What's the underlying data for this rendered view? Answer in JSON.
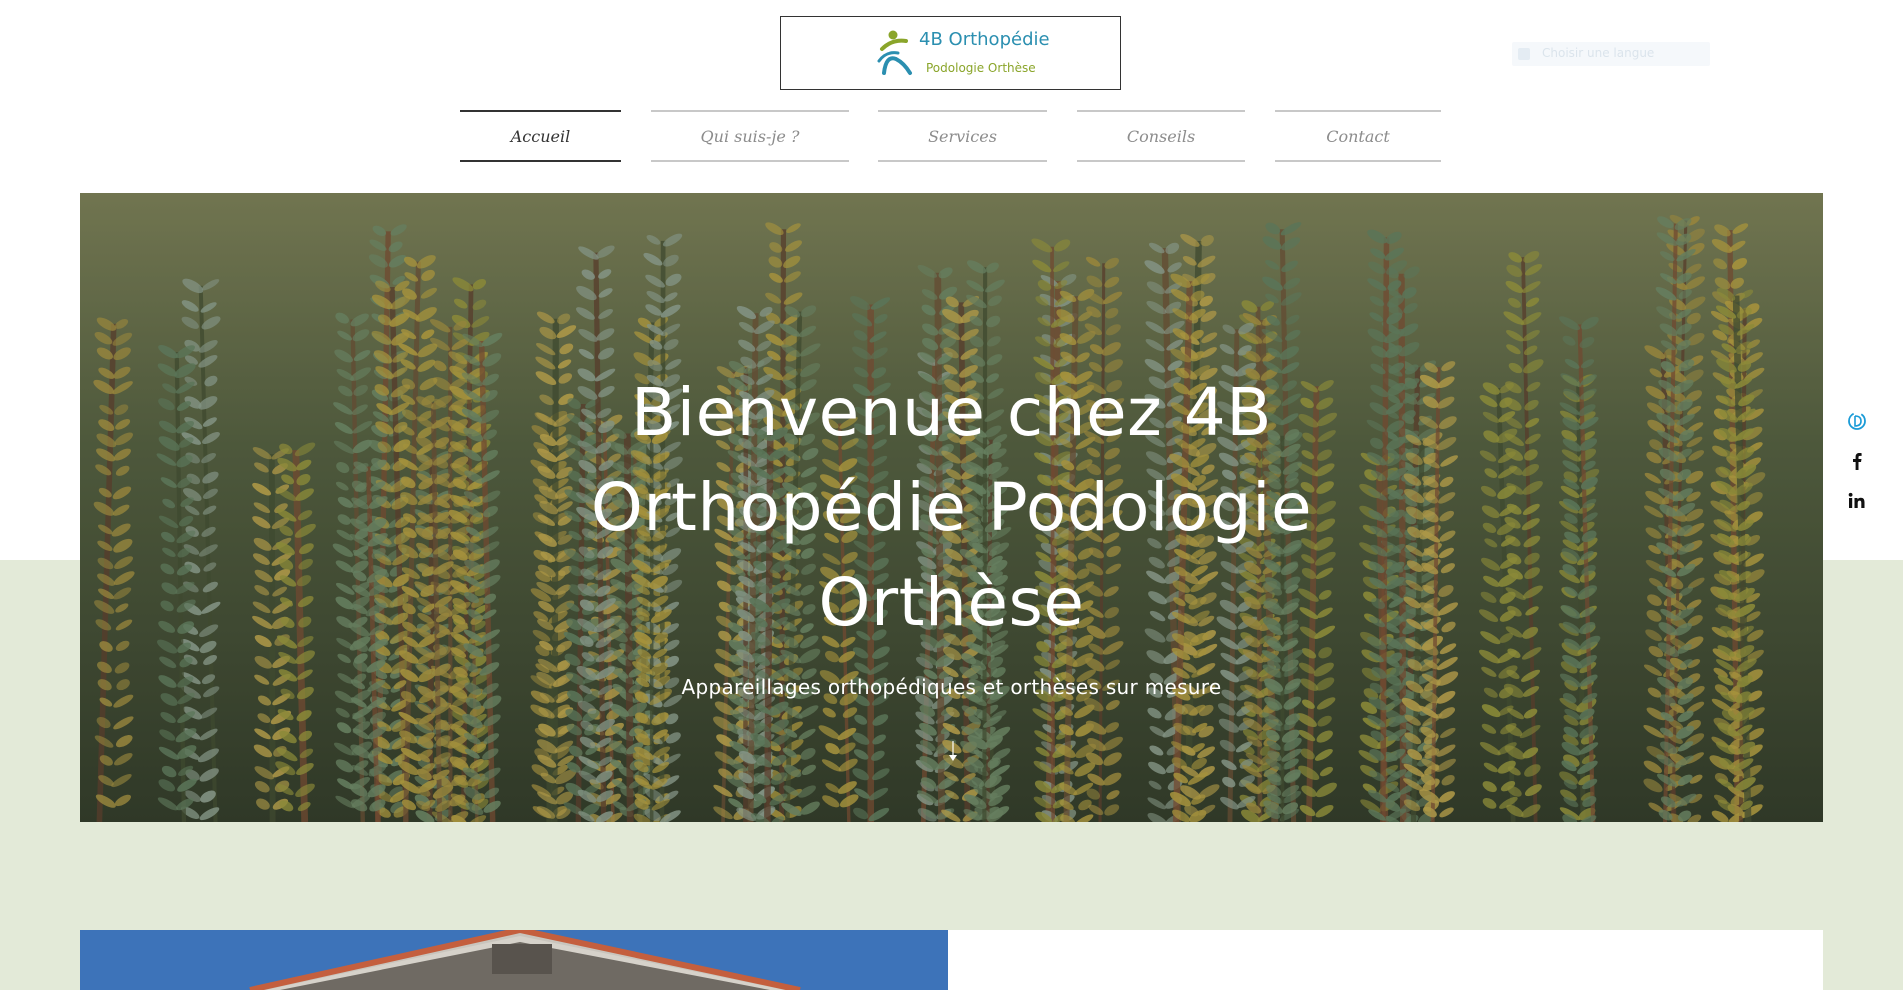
{
  "logo": {
    "title": "4B Orthopédie",
    "subtitle": "Podologie Orthèse"
  },
  "language_widget": {
    "label": "Choisir une langue"
  },
  "nav": {
    "items": [
      {
        "label": "Accueil",
        "active": true
      },
      {
        "label": "Qui suis-je ?",
        "active": false
      },
      {
        "label": "Services",
        "active": false
      },
      {
        "label": "Conseils",
        "active": false
      },
      {
        "label": "Contact",
        "active": false
      }
    ]
  },
  "hero": {
    "title_lines": [
      "Bienvenue chez 4B",
      "Orthopédie Podologie",
      "Orthèse"
    ],
    "subtitle": "Appareillages orthopédiques  et orthèses sur mesure"
  },
  "social": {
    "icons": [
      "doctolib-icon",
      "facebook-icon",
      "linkedin-icon"
    ]
  },
  "colors": {
    "accent_blue": "#2b8fb0",
    "accent_green": "#8aa52a",
    "band_green": "#e3ead8",
    "nav_active": "#333333",
    "nav_inactive": "#8c8c8c"
  }
}
